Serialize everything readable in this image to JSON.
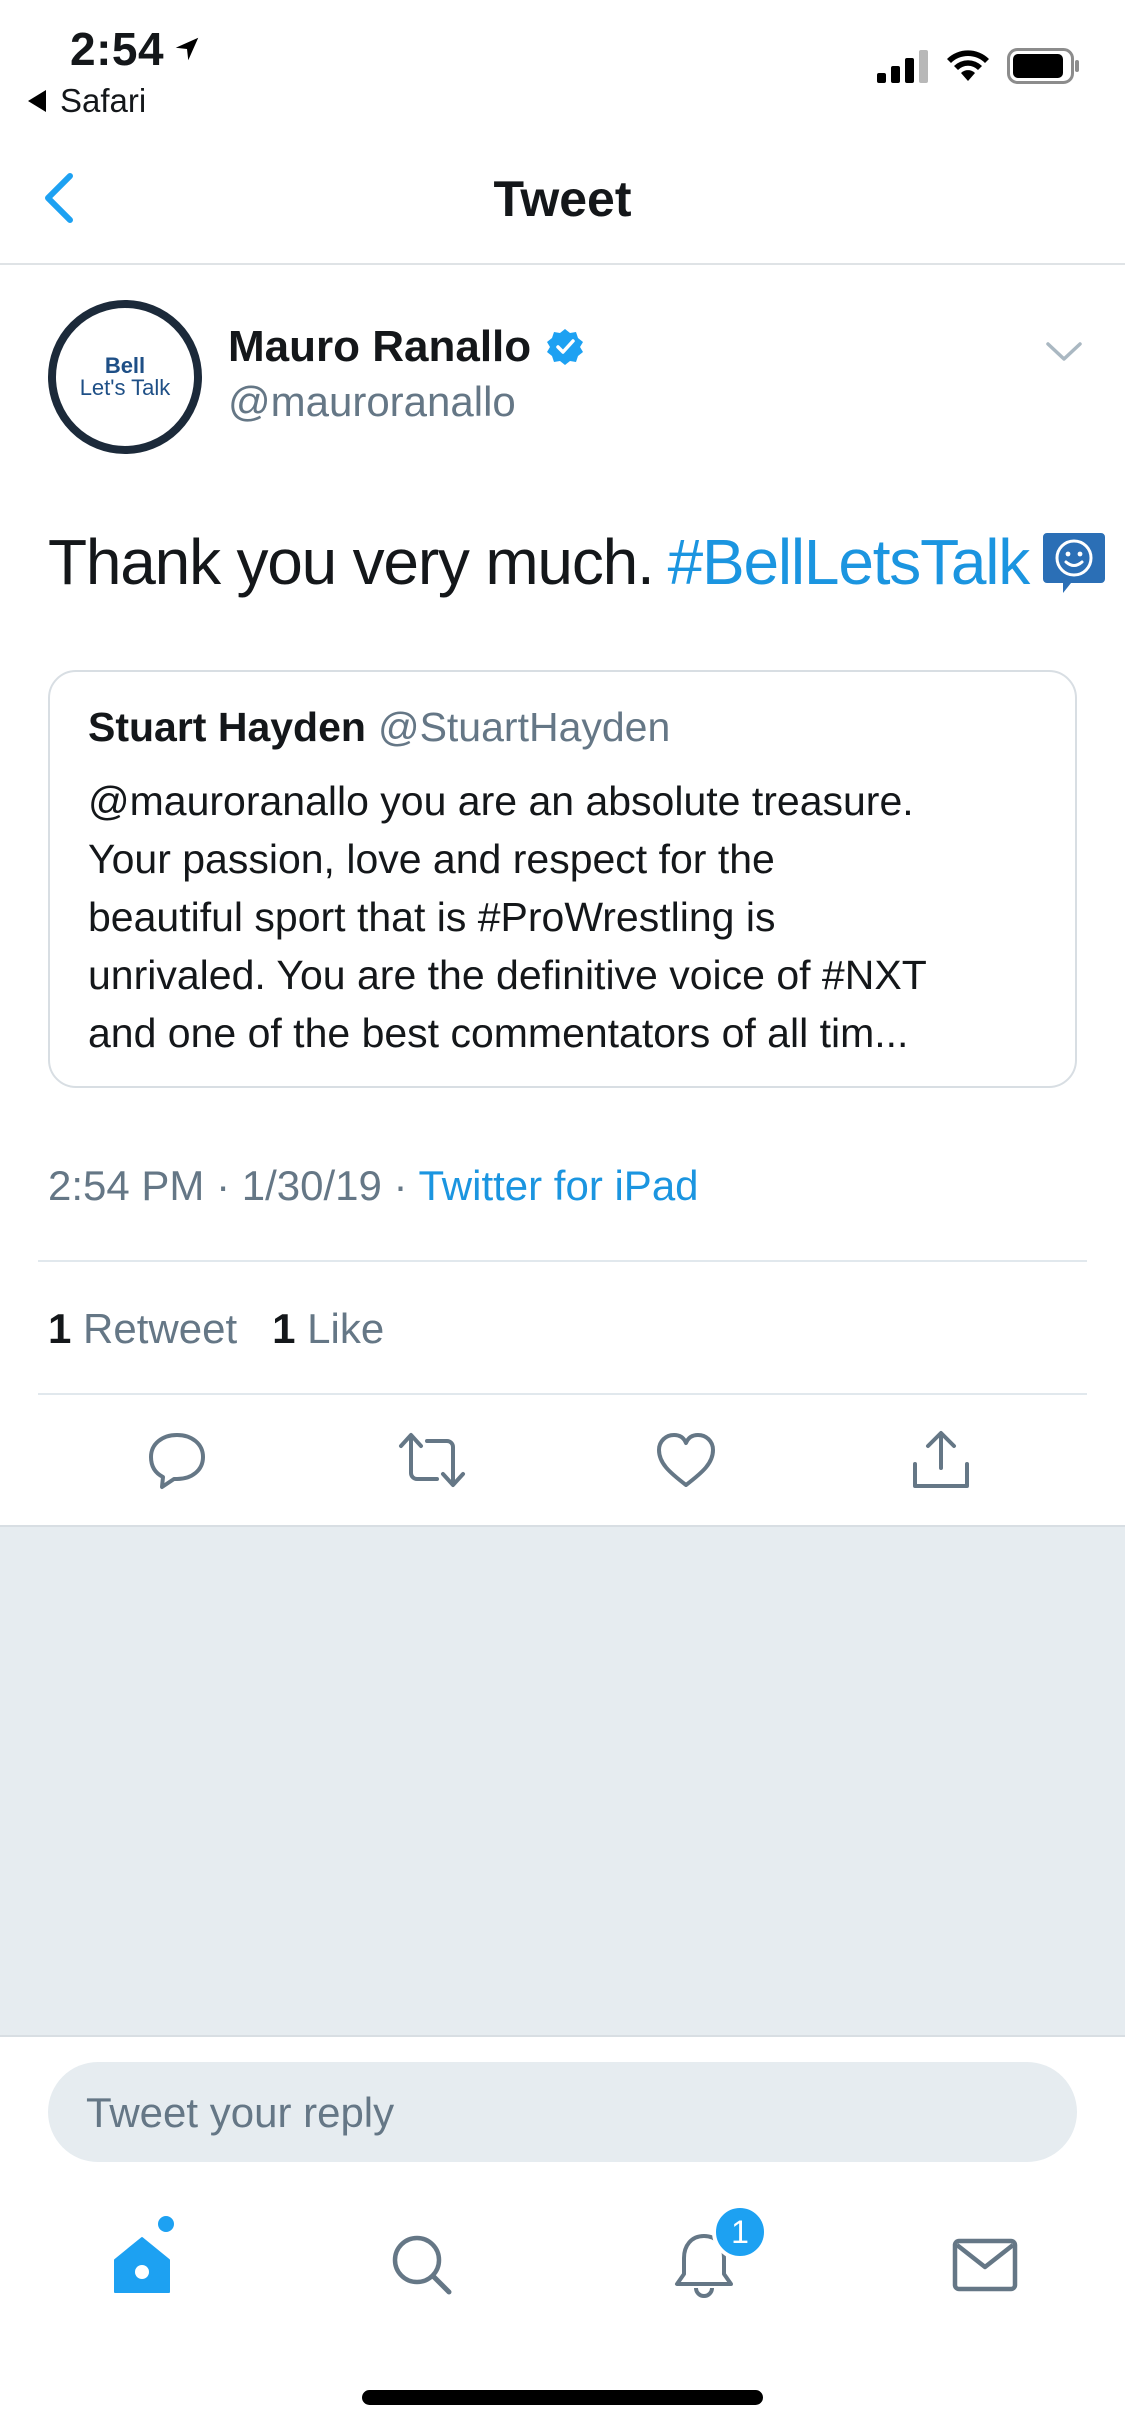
{
  "status_bar": {
    "time": "2:54",
    "back_label": "Safari"
  },
  "nav": {
    "title": "Tweet"
  },
  "tweet": {
    "author_name": "Mauro Ranallo",
    "author_handle": "@mauroranallo",
    "avatar_text_top": "Bell",
    "avatar_text_bottom": "Let's Talk",
    "text": "Thank you very much.",
    "hashtag": "#BellLetsTalk",
    "timestamp": "2:54 PM · 1/30/19 · ",
    "source": "Twitter for iPad",
    "retweet_count": "1",
    "retweet_label": "Retweet",
    "like_count": "1",
    "like_label": "Like"
  },
  "quoted_tweet": {
    "author_name": "Stuart Hayden",
    "author_handle": "@StuartHayden",
    "lines": [
      "@mauroranallo you are an absolute treasure.",
      "Your passion, love and respect for the",
      "beautiful sport that is #ProWrestling is",
      "unrivaled. You are the definitive voice of #NXT",
      "and one of the best commentators of all tim..."
    ]
  },
  "reply": {
    "placeholder": "Tweet your reply"
  },
  "tab_bar": {
    "notification_badge": "1"
  },
  "colors": {
    "accent": "#1da1f2",
    "link": "#1b95e0",
    "secondary_text": "#657786",
    "background_grey": "#e6ecf0"
  }
}
